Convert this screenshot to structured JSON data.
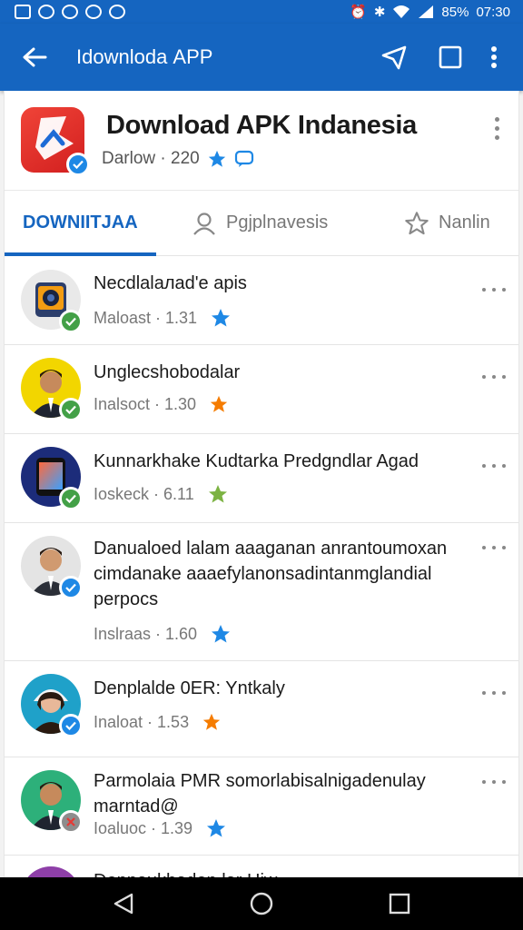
{
  "status_bar": {
    "battery_text": "85%",
    "time": "07:30"
  },
  "app_bar": {
    "title": "Idownlodа APP"
  },
  "header": {
    "app_name": "Download APK Indanesia",
    "meta": "Darlow · 220"
  },
  "tabs": [
    {
      "label": "DOWNIITJAA",
      "icon": ""
    },
    {
      "label": "Pgjplnavesis",
      "icon": "person-icon"
    },
    {
      "label": "Nanlin",
      "icon": "star-icon"
    }
  ],
  "items": [
    {
      "title": "Necdlalaлad'e apis",
      "meta": "Maloast · 1.31",
      "avatar": "app-icon",
      "badge": "green",
      "star_color": "#1e88e5"
    },
    {
      "title": "Unglecshobodalar",
      "meta": "Inalsoct · 1.30",
      "avatar": "man-yellow",
      "badge": "green",
      "star_color": "#f57c00"
    },
    {
      "title": "Kunnarkhake Kudtarka Predgndlar Agad",
      "meta": "Ioskeck · 6.11",
      "avatar": "phone-icon",
      "badge": "green",
      "star_color": "#7cb342"
    },
    {
      "title": "Danualoed lalam aaaganan anrantoumoxan cimdanake aaaefylanonsadintanmglandial perpocs",
      "meta": "Inslraas · 1.60",
      "avatar": "man-grey",
      "badge": "blue",
      "star_color": "#1e88e5"
    },
    {
      "title": "Denplalde 0ER: Yntkaly",
      "meta": "Inaloat · 1.53",
      "avatar": "woman-blue",
      "badge": "blue",
      "star_color": "#f57c00"
    },
    {
      "title": "Parmolaia PMR somorlabisalnigadenulay marntad@",
      "meta": "Ioaluoc · 1.39",
      "avatar": "man-green",
      "badge": "grey",
      "star_color": "#1e88e5"
    },
    {
      "title": "Dennaukhaden lar Hiw",
      "meta": "",
      "avatar": "purple",
      "badge": "",
      "star_color": "#1e88e5"
    }
  ]
}
